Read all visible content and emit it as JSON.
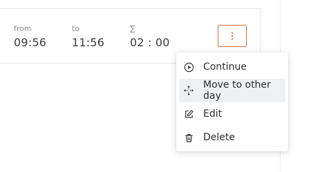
{
  "entry": {
    "from": {
      "label": "from",
      "value": "09:56"
    },
    "to": {
      "label": "to",
      "value": "11:56"
    },
    "duration": {
      "label": "∑",
      "value": "02 : 00"
    }
  },
  "actions_button": {
    "icon": "more-vertical-icon"
  },
  "menu": {
    "items": [
      {
        "label": "Continue",
        "icon": "play-circle-icon",
        "highlighted": false
      },
      {
        "label": "Move to other day",
        "icon": "move-arrows-icon",
        "highlighted": true
      },
      {
        "label": "Edit",
        "icon": "edit-icon",
        "highlighted": false
      },
      {
        "label": "Delete",
        "icon": "trash-icon",
        "highlighted": false
      }
    ]
  },
  "colors": {
    "accent": "#e36a3c",
    "text": "#3b3b3b",
    "muted": "#8d8d8d",
    "highlight": "#eef0f2"
  }
}
